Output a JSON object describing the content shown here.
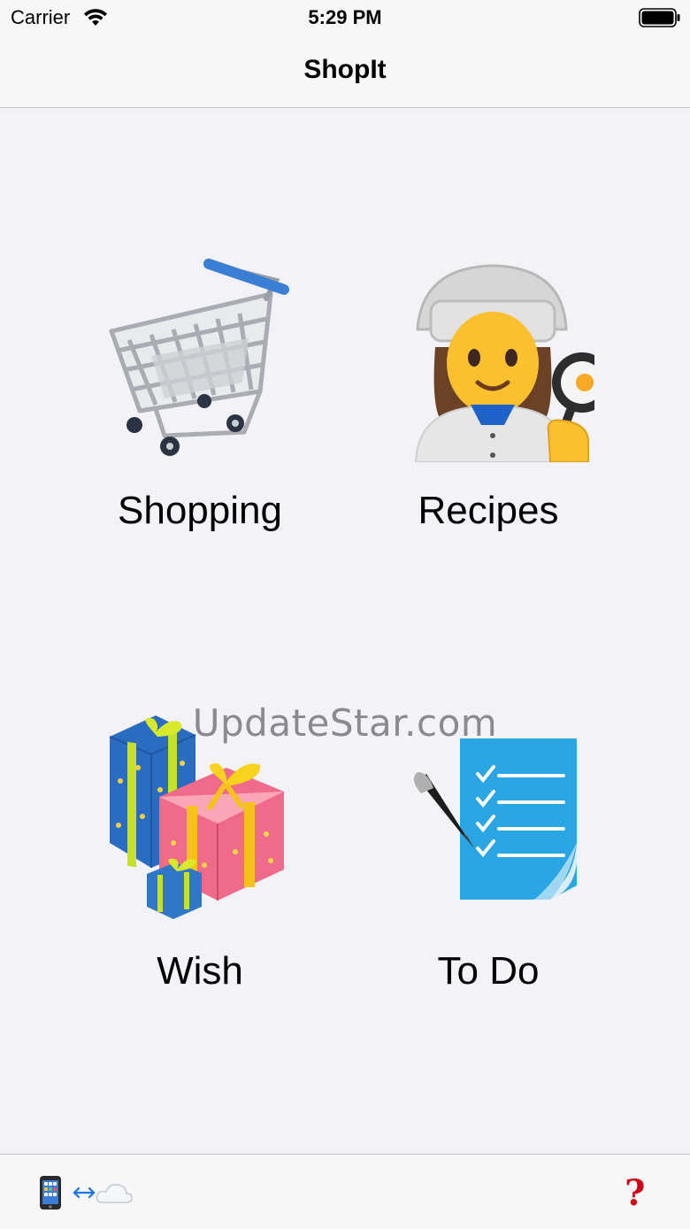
{
  "status_bar": {
    "carrier": "Carrier",
    "time": "5:29 PM",
    "wifi_icon": "wifi-icon",
    "battery_icon": "battery-icon"
  },
  "nav": {
    "title": "ShopIt"
  },
  "tiles": [
    {
      "label": "Shopping",
      "icon": "shopping-cart-icon"
    },
    {
      "label": "Recipes",
      "icon": "woman-cook-icon"
    },
    {
      "label": "Wish",
      "icon": "gift-boxes-icon"
    },
    {
      "label": "To Do",
      "icon": "checklist-icon"
    }
  ],
  "watermark": "UpdateStar.com",
  "toolbar": {
    "sync_icon": "phone-cloud-sync-icon",
    "help_icon": "question-mark-icon",
    "help_symbol": "?",
    "help_color": "#d0021b",
    "sync_arrow_color": "#1a73e8"
  }
}
